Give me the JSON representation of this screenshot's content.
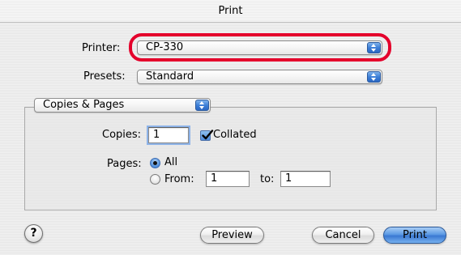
{
  "window": {
    "title": "Print"
  },
  "printer": {
    "label": "Printer:",
    "value": "CP-330"
  },
  "presets": {
    "label": "Presets:",
    "value": "Standard"
  },
  "panel_menu": {
    "value": "Copies & Pages"
  },
  "copies": {
    "label": "Copies:",
    "value": "1",
    "collated_label": "Collated",
    "collated_checked": true
  },
  "pages": {
    "label": "Pages:",
    "all_label": "All",
    "from_label": "From:",
    "from_value": "1",
    "to_label": "to:",
    "to_value": "1",
    "selected": "all"
  },
  "buttons": {
    "help": "?",
    "preview": "Preview",
    "cancel": "Cancel",
    "print": "Print"
  },
  "colors": {
    "highlight_ring": "#e4002b",
    "aqua_blue": "#3c7fd7"
  },
  "icons": {
    "popup_arrows": "updown-arrows-icon",
    "checkbox": "checkmark-icon",
    "help": "question-mark-icon"
  }
}
